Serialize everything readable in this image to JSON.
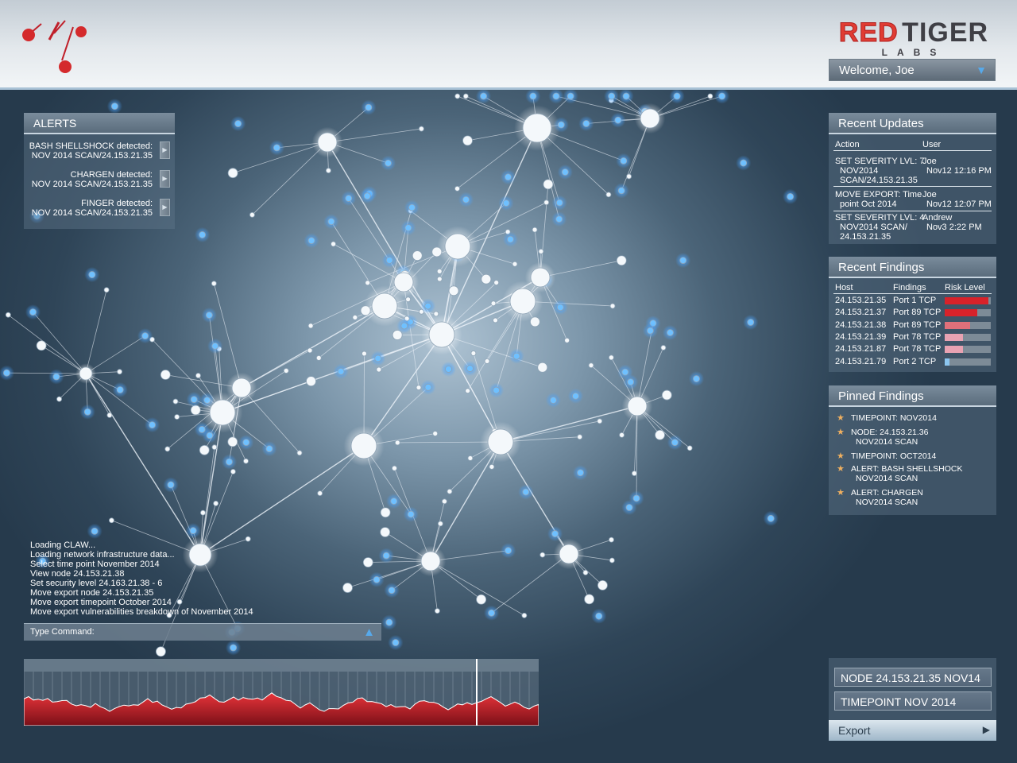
{
  "brand": {
    "red": "RED",
    "dark": "TIGER",
    "sub": "LABS"
  },
  "user_menu": {
    "label": "Welcome, Joe",
    "icon": "triangle-down-icon"
  },
  "alerts": {
    "title": "ALERTS",
    "items": [
      {
        "line1": "BASH SHELLSHOCK detected:",
        "line2": "NOV 2014 SCAN/24.153.21.35"
      },
      {
        "line1": "CHARGEN detected:",
        "line2": "NOV 2014 SCAN/24.153.21.35"
      },
      {
        "line1": "FINGER detected:",
        "line2": "NOV 2014 SCAN/24.153.21.35"
      }
    ]
  },
  "recent_updates": {
    "title": "Recent Updates",
    "col_action": "Action",
    "col_user": "User",
    "rows": [
      {
        "action": [
          "SET SEVERITY LVL: 7",
          "NOV2014",
          "SCAN/24.153.21.35"
        ],
        "user": "Joe",
        "date": "Nov12 12:16 PM"
      },
      {
        "action": [
          "MOVE EXPORT: Time",
          "point Oct 2014"
        ],
        "user": "Joe",
        "date": "Nov12 12:07 PM"
      },
      {
        "action": [
          "SET SEVERITY LVL: 4",
          "NOV2014 SCAN/",
          "24.153.21.35"
        ],
        "user": "Andrew",
        "date": "Nov3 2:22 PM"
      }
    ]
  },
  "recent_findings": {
    "title": "Recent Findings",
    "col_host": "Host",
    "col_findings": "Findings",
    "col_risk": "Risk Level",
    "rows": [
      {
        "host": "24.153.21.35",
        "finding": "Port 1 TCP",
        "risk": 0.95,
        "color": "#d8222a"
      },
      {
        "host": "24.153.21.37",
        "finding": "Port 89 TCP",
        "risk": 0.7,
        "color": "#d8222a"
      },
      {
        "host": "24.153.21.38",
        "finding": "Port 89 TCP",
        "risk": 0.55,
        "color": "#e0707a"
      },
      {
        "host": "24.153.21.39",
        "finding": "Port 78 TCP",
        "risk": 0.4,
        "color": "#e8a2b2"
      },
      {
        "host": "24.153.21.87",
        "finding": "Port 78 TCP",
        "risk": 0.4,
        "color": "#e8a2b2"
      },
      {
        "host": "24.153.21.79",
        "finding": "Port 2 TCP",
        "risk": 0.1,
        "color": "#8cc6f0"
      }
    ]
  },
  "pinned_findings": {
    "title": "Pinned Findings",
    "items": [
      [
        "TIMEPOINT: NOV2014"
      ],
      [
        "NODE: 24.153.21.36",
        "NOV2014 SCAN"
      ],
      [
        "TIMEPOINT: OCT2014"
      ],
      [
        "ALERT: BASH SHELLSHOCK",
        "NOV2014 SCAN"
      ],
      [
        "ALERT: CHARGEN",
        "NOV2014 SCAN"
      ]
    ]
  },
  "console_log": [
    "Loading CLAW...",
    "Loading network infrastructure data...",
    "Select time point November 2014",
    "View node 24.153.21.38",
    "Set security level 24.163.21.38 - 6",
    "Move export node 24.153.21.35",
    "Move export timepoint October 2014",
    "Move export vulnerabilities breakdown of November 2014"
  ],
  "command": {
    "label": "Type Command:",
    "icon": "triangle-up-icon"
  },
  "node_field": "NODE 24.153.21.35 NOV14",
  "timepoint_field": "TIMEPOINT NOV 2014",
  "export": {
    "label": "Export",
    "icon": "play-icon"
  },
  "colors": {
    "accent_blue": "#57a9ea",
    "brand_red": "#e03c33",
    "risk_high": "#d8222a"
  }
}
